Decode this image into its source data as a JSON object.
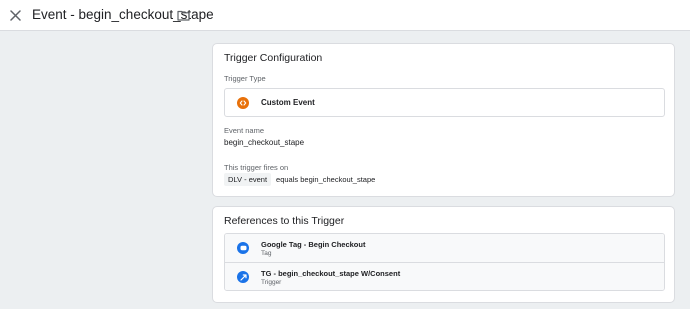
{
  "header": {
    "title": "Event - begin_checkout_stape",
    "close_icon": "close-icon",
    "folder_icon": "folder-icon"
  },
  "trigger_config": {
    "card_title": "Trigger Configuration",
    "type_label": "Trigger Type",
    "type_name": "Custom Event",
    "type_icon": "custom-event-icon",
    "type_icon_color": "#e8710a",
    "event_name_label": "Event name",
    "event_name_value": "begin_checkout_stape",
    "fires_on_label": "This trigger fires on",
    "condition": {
      "variable": "DLV - event",
      "operator_value": "equals begin_checkout_stape"
    }
  },
  "references": {
    "card_title": "References to this Trigger",
    "items": [
      {
        "name": "Google Tag - Begin Checkout",
        "type": "Tag",
        "icon": "tag-icon",
        "icon_color": "#1a73e8"
      },
      {
        "name": "TG - begin_checkout_stape W/Consent",
        "type": "Trigger",
        "icon": "trigger-icon",
        "icon_color": "#1a73e8"
      }
    ]
  }
}
